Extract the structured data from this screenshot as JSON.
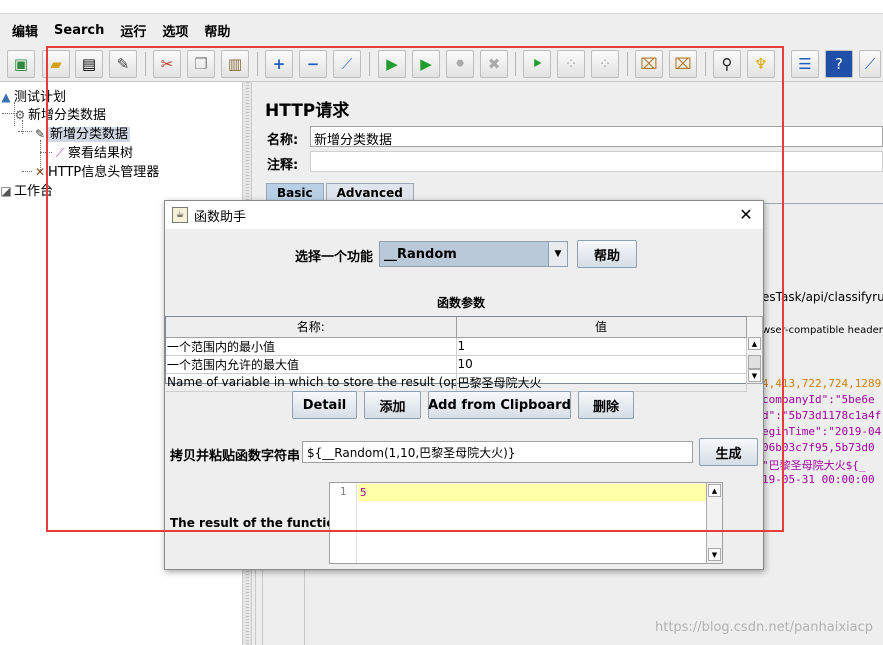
{
  "menubar": {
    "items": [
      "编辑",
      "Search",
      "运行",
      "选项",
      "帮助"
    ]
  },
  "toolbar": {
    "buttons": [
      {
        "icon": "templates-icon"
      },
      {
        "icon": "open-icon"
      },
      {
        "icon": "save-icon"
      },
      {
        "icon": "save-as-icon"
      },
      {
        "icon": "cut-icon"
      },
      {
        "icon": "copy-icon"
      },
      {
        "icon": "paste-icon"
      },
      {
        "icon": "expand-icon"
      },
      {
        "icon": "collapse-icon"
      },
      {
        "icon": "toggle-icon"
      },
      {
        "icon": "start-icon"
      },
      {
        "icon": "start-no-pause-icon"
      },
      {
        "icon": "stop-icon"
      },
      {
        "icon": "shutdown-icon"
      },
      {
        "icon": "remote-start-icon"
      },
      {
        "icon": "remote-stop-icon"
      },
      {
        "icon": "remote-shutdown-icon"
      },
      {
        "icon": "clear-icon"
      },
      {
        "icon": "clear-all-icon"
      },
      {
        "icon": "search-icon"
      },
      {
        "icon": "reset-search-icon"
      },
      {
        "icon": "function-helper-icon"
      },
      {
        "icon": "help-icon"
      },
      {
        "icon": "more-icon"
      }
    ]
  },
  "tree": {
    "items": [
      {
        "label": "测试计划",
        "icon": "test-plan-icon"
      },
      {
        "label": "新增分类数据",
        "icon": "thread-group-icon"
      },
      {
        "label": "新增分类数据",
        "icon": "http-sampler-icon",
        "selected": true
      },
      {
        "label": "察看结果树",
        "icon": "results-tree-icon"
      },
      {
        "label": "HTTP信息头管理器",
        "icon": "header-manager-icon"
      },
      {
        "label": "工作台",
        "icon": "workbench-icon"
      }
    ]
  },
  "http_panel": {
    "title": "HTTP请求",
    "name_label": "名称:",
    "name_value": "新增分类数据",
    "comment_label": "注释:",
    "tabs": [
      "Basic",
      "Advanced"
    ],
    "path_fragment": "esTask/api/classifyrule",
    "checkbox_fragment": "wser-compatible headers",
    "body_lines": [
      {
        "text": "4,413,722,724,1289",
        "color": "#d08000"
      },
      {
        "text": "companyId\":\"5be6e",
        "color": "#a000a0"
      },
      {
        "text": "d\":\"5b73d1178c1a4f",
        "color": "#a000a0"
      },
      {
        "text": "eginTime\":\"2019-04",
        "color": "#a000a0"
      },
      {
        "text": "06b03c7f95,5b73d0",
        "color": "#a000a0"
      },
      {
        "text": "\"巴黎圣母院大火${_",
        "color": "#a000a0"
      },
      {
        "text": "19-05-31 00:00:00",
        "color": "#a000a0"
      }
    ]
  },
  "dialog": {
    "title": "函数助手",
    "select_label": "选择一个功能",
    "selected_function": "__Random",
    "help_button": "帮助",
    "params_heading": "函数参数",
    "table_headers": [
      "名称:",
      "值"
    ],
    "params": [
      {
        "name": "一个范围内的最小值",
        "value": "1"
      },
      {
        "name": "一个范围内允许的最大值",
        "value": "10"
      },
      {
        "name": "Name of variable in which to store the result (optio...",
        "value": "巴黎圣母院大火"
      }
    ],
    "buttons": {
      "detail": "Detail",
      "add": "添加",
      "add_clipboard": "Add from Clipboard",
      "delete": "删除"
    },
    "string_label": "拷贝并粘贴函数字符串",
    "function_string": "${__Random(1,10,巴黎圣母院大火)}",
    "generate_button": "生成",
    "result_label": "The result of the function is",
    "result_line_number": "1",
    "result_value": "5"
  },
  "watermark": "https://blog.csdn.net/panhaixiacp",
  "colors": {
    "highlight_box": "#e53c3c",
    "selected_tree_bg": "#cfd8e4",
    "combo_bg": "#b9c9d9",
    "result_line_bg": "#ffffaa"
  }
}
